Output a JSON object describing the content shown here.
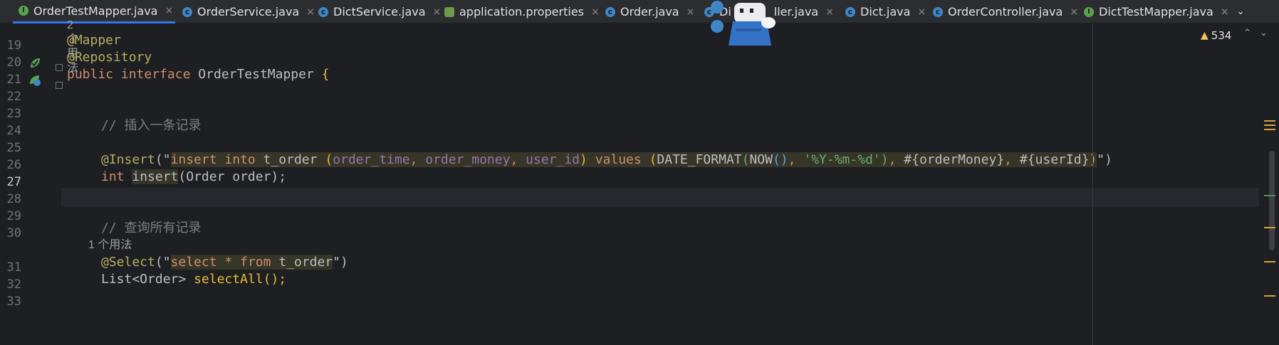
{
  "tabs": [
    {
      "label": "OrderTestMapper.java",
      "kind": "interface",
      "active": true
    },
    {
      "label": "OrderService.java",
      "kind": "class"
    },
    {
      "label": "DictService.java",
      "kind": "class"
    },
    {
      "label": "application.properties",
      "kind": "properties"
    },
    {
      "label": "Order.java",
      "kind": "class"
    },
    {
      "label": "Di",
      "kind": "class"
    },
    {
      "label": "ller.java",
      "kind": "class"
    },
    {
      "label": "Dict.java",
      "kind": "class"
    },
    {
      "label": "OrderController.java",
      "kind": "class"
    },
    {
      "label": "DictTestMapper.java",
      "kind": "interface"
    }
  ],
  "close_glyph": "×",
  "more_tabs_glyph": "⌄",
  "inspection": {
    "warning_count": "534",
    "warning_icon": "warning-icon",
    "nav_up": "⌃",
    "nav_down": "⌄"
  },
  "usage_hint_top": "2 个用法",
  "lines": [
    {
      "no": "19"
    },
    {
      "no": "20"
    },
    {
      "no": "21"
    },
    {
      "no": "22"
    },
    {
      "no": "23"
    },
    {
      "no": "24"
    },
    {
      "no": "25"
    },
    {
      "no": "26"
    },
    {
      "no": "27",
      "current": true
    },
    {
      "no": "28"
    },
    {
      "no": "29"
    },
    {
      "no": "30"
    },
    {
      "no": "31"
    },
    {
      "no": "32"
    },
    {
      "no": "33"
    }
  ],
  "code": {
    "l19": "@Mapper",
    "l20": "@Repository",
    "l21_kw1": "public",
    "l21_kw2": "interface",
    "l21_name": "OrderTestMapper",
    "l21_brace": "{",
    "l24_comment": "// 插入一条记录",
    "l26_annot": "@Insert",
    "l26_sql_kw1": "insert",
    "l26_sql_kw2": "into",
    "l26_table": "t_order",
    "l26_col1": "order_time",
    "l26_col2": "order_money",
    "l26_col3": "user_id",
    "l26_values": "values",
    "l26_fn1": "DATE_FORMAT",
    "l26_fn2": "NOW",
    "l26_fmt": "'%Y-%m-%d'",
    "l26_p1": "orderMoney",
    "l26_p2": "userId",
    "l27_type": "int",
    "l27_method": "insert",
    "l27_args": "(Order order);",
    "l30_comment": "// 查询所有记录",
    "usage_hint_31": "1 个用法",
    "l31_annot": "@Select",
    "l31_sql_kw1": "select",
    "l31_star": "*",
    "l31_sql_kw2": "from",
    "l31_table": "t_order",
    "l32_type": "List<Order>",
    "l32_method": "selectAll",
    "l32_rest": "();"
  },
  "colors": {
    "accent": "#3574f0",
    "keyword": "#cf8e6d",
    "annotation": "#b3ae60",
    "string": "#6aab73",
    "warning": "#f2c55c"
  }
}
